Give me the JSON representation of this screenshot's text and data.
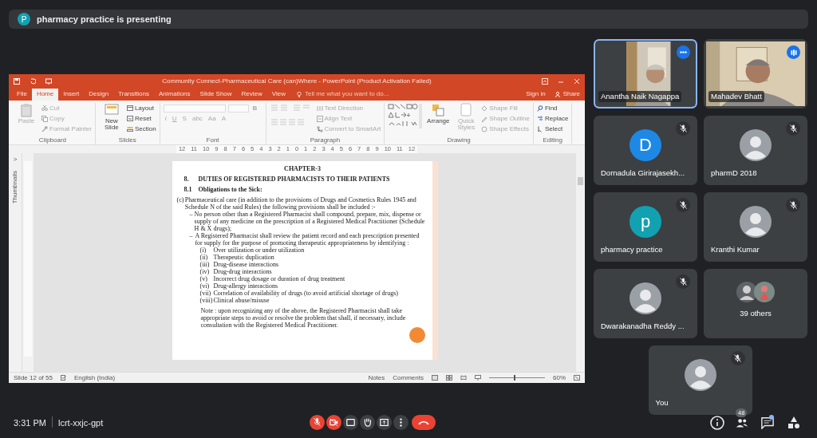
{
  "presenting_banner": {
    "avatar_letter": "P",
    "text": "pharmacy practice is presenting"
  },
  "powerpoint": {
    "title": "Community Connect-Pharmaceutical Care (can)Where - PowerPoint (Product Activation Failed)",
    "tabs": [
      {
        "label": "File",
        "selected": false
      },
      {
        "label": "Home",
        "selected": true
      },
      {
        "label": "Insert",
        "selected": false
      },
      {
        "label": "Design",
        "selected": false
      },
      {
        "label": "Transitions",
        "selected": false
      },
      {
        "label": "Animations",
        "selected": false
      },
      {
        "label": "Slide Show",
        "selected": false
      },
      {
        "label": "Review",
        "selected": false
      },
      {
        "label": "View",
        "selected": false
      }
    ],
    "tell_me": "Tell me what you want to do...",
    "sign_in": "Sign in",
    "share": "Share",
    "ribbon": [
      {
        "label": "Clipboard",
        "commands": [
          {
            "kind": "large",
            "label": "Paste",
            "disabled": true
          },
          {
            "kind": "small",
            "label": "Cut",
            "disabled": true
          },
          {
            "kind": "small",
            "label": "Copy",
            "disabled": true
          },
          {
            "kind": "small",
            "label": "Format Painter",
            "disabled": true
          }
        ]
      },
      {
        "label": "Slides",
        "commands": [
          {
            "kind": "large",
            "label": "New Slide",
            "disabled": false
          },
          {
            "kind": "small",
            "label": "Layout",
            "disabled": false
          },
          {
            "kind": "small",
            "label": "Reset",
            "disabled": false
          },
          {
            "kind": "small",
            "label": "Section",
            "disabled": false
          }
        ]
      },
      {
        "label": "Font",
        "commands": [
          {
            "kind": "combo",
            "disabled": true
          },
          {
            "kind": "combo",
            "disabled": true
          },
          {
            "kind": "format",
            "label": "B",
            "disabled": true
          },
          {
            "kind": "format",
            "label": "I",
            "disabled": true
          },
          {
            "kind": "format",
            "label": "U",
            "disabled": true
          },
          {
            "kind": "format",
            "label": "S",
            "disabled": true
          },
          {
            "kind": "format",
            "label": "abc",
            "disabled": true
          },
          {
            "kind": "format",
            "label": "Aa",
            "disabled": true
          },
          {
            "kind": "format",
            "label": "A",
            "disabled": true
          }
        ]
      },
      {
        "label": "Paragraph",
        "commands": [
          {
            "kind": "glyphs",
            "disabled": true
          },
          {
            "kind": "small",
            "label": "Text Direction",
            "disabled": true
          },
          {
            "kind": "small",
            "label": "Align Text",
            "disabled": true
          },
          {
            "kind": "small",
            "label": "Convert to SmartArt",
            "disabled": true
          }
        ]
      },
      {
        "label": "Drawing",
        "commands": [
          {
            "kind": "gallery",
            "disabled": false
          },
          {
            "kind": "large",
            "label": "Arrange",
            "disabled": false
          },
          {
            "kind": "large",
            "label": "Quick Styles",
            "disabled": true
          },
          {
            "kind": "small",
            "label": "Shape Fill",
            "disabled": true
          },
          {
            "kind": "small",
            "label": "Shape Outline",
            "disabled": true
          },
          {
            "kind": "small",
            "label": "Shape Effects",
            "disabled": true
          }
        ]
      },
      {
        "label": "Editing",
        "commands": [
          {
            "kind": "small",
            "label": "Find",
            "disabled": false
          },
          {
            "kind": "small",
            "label": "Replace",
            "disabled": false
          },
          {
            "kind": "small",
            "label": "Select",
            "disabled": false
          }
        ]
      }
    ],
    "ruler": [
      "12",
      "11",
      "10",
      "9",
      "8",
      "7",
      "6",
      "5",
      "4",
      "3",
      "2",
      "1",
      "0",
      "1",
      "2",
      "3",
      "4",
      "5",
      "6",
      "7",
      "8",
      "9",
      "10",
      "11",
      "12"
    ],
    "thumbnails_label": "Thumbnails",
    "thumbnails_toggle": ">",
    "document": {
      "chapter": "CHAPTER-3",
      "section": {
        "number": "8.",
        "title": "DUTIES OF REGISTERED PHARMACISTS TO THEIR PATIENTS"
      },
      "subsection": {
        "number": "8.1",
        "title": "Obligations to the Sick:"
      },
      "clause": {
        "label": "(c)",
        "text": "Pharmaceutical care (in addition to the provisions of Drugs and Cosmetics Rules 1945 and Schedule N of the said Rules) the following provisions shall be included :-"
      },
      "bullets": [
        {
          "marker": "–",
          "text": "No person other than a  Registered Pharmacist shall compound, prepare, mix, dispense or supply of any medicine on the prescription of a Registered Medical Practitioner (Schedule H & X drugs);"
        },
        {
          "marker": "–",
          "text": "A Registered Pharmacist shall review the patient record and each prescription presented for supply for the purpose of promoting therapeutic appropriateness by identifying :"
        }
      ],
      "items": [
        {
          "label": "(i)",
          "text": "Over utilization or under utilization"
        },
        {
          "label": "(ii)",
          "text": "Therapeutic duplication"
        },
        {
          "label": "(iii)",
          "text": "Drug-disease interactions"
        },
        {
          "label": "(iv)",
          "text": "Drug-drug interactions"
        },
        {
          "label": "(v)",
          "text": "Incorrect drug dosage or duration of drug treatment"
        },
        {
          "label": "(vi)",
          "text": "Drug-allergy interactions"
        },
        {
          "label": "(vii)",
          "text": "Correlation of availability of drugs (to avoid artificial shortage of drugs)"
        },
        {
          "label": "(viii)",
          "text": "Clinical abuse/misuse"
        }
      ],
      "note": "Note : upon recognizing any of the above, the Registered Pharmacist shall take appropriate steps to avoid or resolve the problem that shall, if necessary, include consultation with the Registered Medical Practitioner."
    },
    "status_bar": {
      "slide": "Slide 12 of 55",
      "language": "English (India)",
      "notes": "Notes",
      "comments": "Comments",
      "zoom": "60%",
      "zoom_slider": {
        "level": 0.45
      }
    }
  },
  "participants": [
    {
      "name": "Anantha Naik Nagappa",
      "kind": "video",
      "selected": true,
      "speaking": false,
      "muted": false
    },
    {
      "name": "Mahadev Bhatt",
      "kind": "video",
      "selected": false,
      "speaking": true,
      "muted": false
    },
    {
      "name": "Dornadula Girirajasekh...",
      "kind": "letter",
      "avatar_letter": "D",
      "color": "#1e88e5",
      "selected": false,
      "speaking": false,
      "muted": true
    },
    {
      "name": "pharmD 2018",
      "selected": false,
      "speaking": false,
      "muted": true
    },
    {
      "name": "pharmacy practice",
      "kind": "letter",
      "avatar_letter": "p",
      "color": "#12a1b0",
      "selected": false,
      "speaking": false,
      "muted": true
    },
    {
      "name": "Kranthi Kumar",
      "selected": false,
      "speaking": false,
      "muted": true
    },
    {
      "name": "Dwarakanadha Reddy ...",
      "selected": false,
      "speaking": false,
      "muted": true
    },
    {
      "name": "39 others",
      "kind": "others",
      "selected": false,
      "speaking": false,
      "muted": false
    },
    {
      "name": "You",
      "selected": false,
      "speaking": false,
      "muted": true
    }
  ],
  "bottom_bar": {
    "time": "3:31 PM",
    "meeting_code": "lcrt-xxjc-gpt",
    "mic_off": true,
    "camera_off": true,
    "people_count": "48",
    "chat_unread": true
  }
}
